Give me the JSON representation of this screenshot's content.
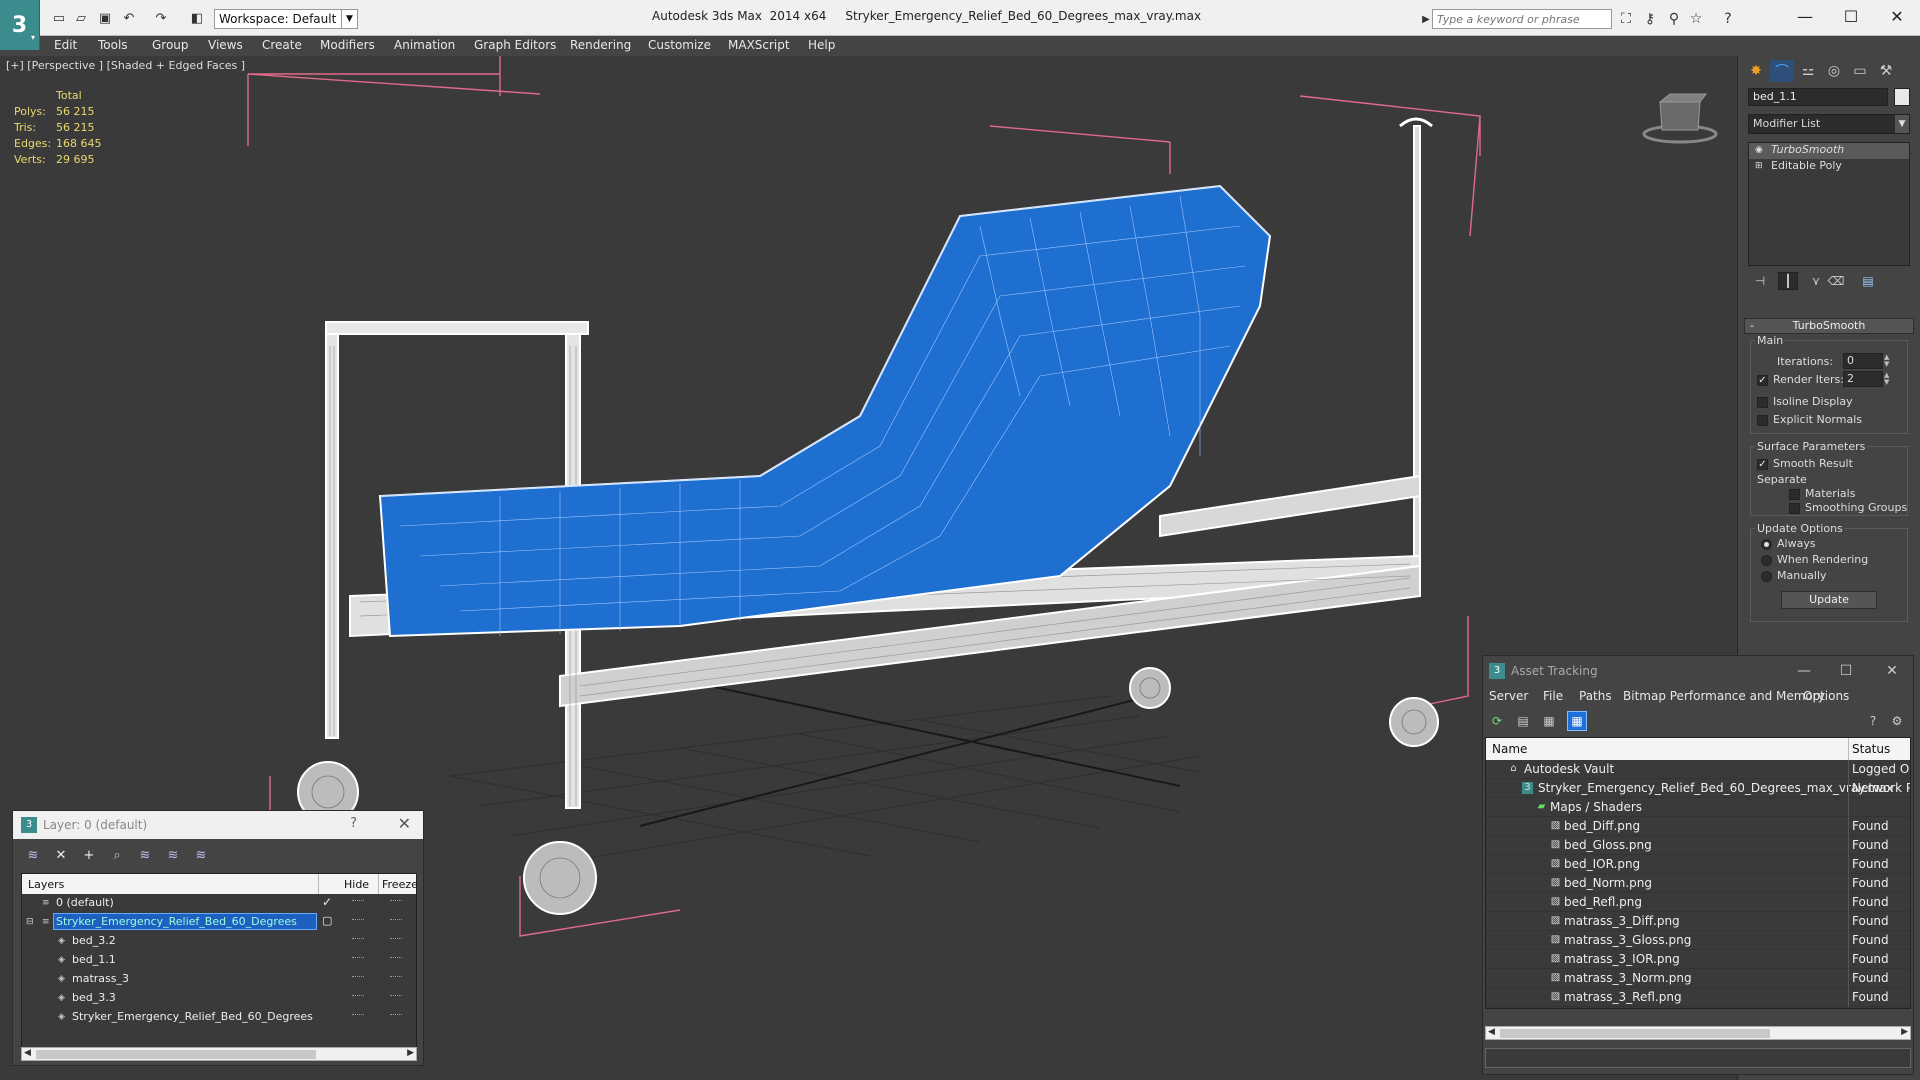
{
  "titlebar": {
    "workspace_label": "Workspace: Default",
    "app_title": "Autodesk 3ds Max  2014 x64     Stryker_Emergency_Relief_Bed_60_Degrees_max_vray.max",
    "search_placeholder": "Type a keyword or phrase"
  },
  "menu": [
    "Edit",
    "Tools",
    "Group",
    "Views",
    "Create",
    "Modifiers",
    "Animation",
    "Graph Editors",
    "Rendering",
    "Customize",
    "MAXScript",
    "Help"
  ],
  "viewport": {
    "label": "[+] [Perspective ] [Shaded + Edged Faces ]",
    "stats": {
      "total_label": "Total",
      "rows": [
        {
          "label": "Polys:",
          "value": "56 215"
        },
        {
          "label": "Tris:",
          "value": "56 215"
        },
        {
          "label": "Edges:",
          "value": "168 645"
        },
        {
          "label": "Verts:",
          "value": "29 695"
        }
      ]
    },
    "colors": {
      "mattress": "#1f6fd0",
      "frame": "#e8e8e8",
      "bbox": "#e06a8a",
      "grid": "#2a2a2a"
    }
  },
  "command_panel": {
    "object_name": "bed_1.1",
    "modifier_list_label": "Modifier List",
    "stack": [
      "TurboSmooth",
      "Editable Poly"
    ],
    "rollout_title": "TurboSmooth",
    "main_group": "Main",
    "iterations_label": "Iterations:",
    "iterations_value": "0",
    "render_iters_label": "Render Iters:",
    "render_iters_value": "2",
    "isoline_label": "Isoline Display",
    "explicit_normals_label": "Explicit Normals",
    "surface_group": "Surface Parameters",
    "smooth_result_label": "Smooth Result",
    "separate_label": "Separate",
    "materials_label": "Materials",
    "smoothing_groups_label": "Smoothing Groups",
    "update_group": "Update Options",
    "always_label": "Always",
    "when_rendering_label": "When Rendering",
    "manually_label": "Manually",
    "update_button": "Update"
  },
  "layer_dialog": {
    "title": "Layer: 0 (default)",
    "col_layers": "Layers",
    "col_hide": "Hide",
    "col_freeze": "Freeze",
    "rows": [
      {
        "name": "0 (default)",
        "indent": 0
      },
      {
        "name": "Stryker_Emergency_Relief_Bed_60_Degrees",
        "indent": 0
      },
      {
        "name": "bed_3.2",
        "indent": 1
      },
      {
        "name": "bed_1.1",
        "indent": 1
      },
      {
        "name": "matrass_3",
        "indent": 1
      },
      {
        "name": "bed_3.3",
        "indent": 1
      },
      {
        "name": "Stryker_Emergency_Relief_Bed_60_Degrees",
        "indent": 1
      }
    ]
  },
  "asset_dialog": {
    "title": "Asset Tracking",
    "menu": [
      "Server",
      "File",
      "Paths",
      "Bitmap Performance and Memory",
      "Options"
    ],
    "col_name": "Name",
    "col_status": "Status",
    "rows": [
      {
        "name": "Autodesk Vault",
        "status": "Logged Ou",
        "level": 0
      },
      {
        "name": "Stryker_Emergency_Relief_Bed_60_Degrees_max_vray.max",
        "status": "Network Pa",
        "level": 1
      },
      {
        "name": "Maps / Shaders",
        "status": "",
        "level": 2
      },
      {
        "name": "bed_Diff.png",
        "status": "Found",
        "level": 3
      },
      {
        "name": "bed_Gloss.png",
        "status": "Found",
        "level": 3
      },
      {
        "name": "bed_IOR.png",
        "status": "Found",
        "level": 3
      },
      {
        "name": "bed_Norm.png",
        "status": "Found",
        "level": 3
      },
      {
        "name": "bed_Refl.png",
        "status": "Found",
        "level": 3
      },
      {
        "name": "matrass_3_Diff.png",
        "status": "Found",
        "level": 3
      },
      {
        "name": "matrass_3_Gloss.png",
        "status": "Found",
        "level": 3
      },
      {
        "name": "matrass_3_IOR.png",
        "status": "Found",
        "level": 3
      },
      {
        "name": "matrass_3_Norm.png",
        "status": "Found",
        "level": 3
      },
      {
        "name": "matrass_3_Refl.png",
        "status": "Found",
        "level": 3
      }
    ]
  }
}
